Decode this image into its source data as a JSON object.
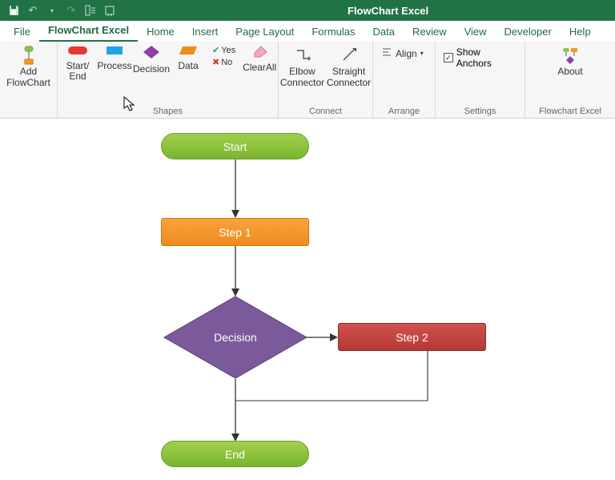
{
  "titlebar": {
    "title": "FlowChart Excel"
  },
  "qat": {
    "save": "save-icon",
    "undo": "undo-icon",
    "redo": "redo-icon"
  },
  "menu": {
    "file": "File",
    "flowchart": "FlowChart Excel",
    "home": "Home",
    "insert": "Insert",
    "page_layout": "Page Layout",
    "formulas": "Formulas",
    "data": "Data",
    "review": "Review",
    "view": "View",
    "developer": "Developer",
    "help": "Help"
  },
  "ribbon": {
    "add_group": {
      "add_flowchart": "Add\nFlowChart"
    },
    "shapes_group": {
      "label": "Shapes",
      "start_end": "Start/\nEnd",
      "process": "Process",
      "decision": "Decision",
      "data": "Data",
      "yes": "Yes",
      "no": "No",
      "clear_all": "ClearAll"
    },
    "connect_group": {
      "label": "Connect",
      "elbow": "Elbow\nConnector",
      "straight": "Straight\nConnector"
    },
    "arrange_group": {
      "label": "Arrange",
      "align": "Align"
    },
    "settings_group": {
      "label": "Settings",
      "show_anchors": "Show Anchors"
    },
    "about_group": {
      "label": "Flowchart Excel",
      "about": "About"
    }
  },
  "flowchart": {
    "start": "Start",
    "step1": "Step 1",
    "decision": "Decision",
    "step2": "Step 2",
    "end": "End"
  }
}
